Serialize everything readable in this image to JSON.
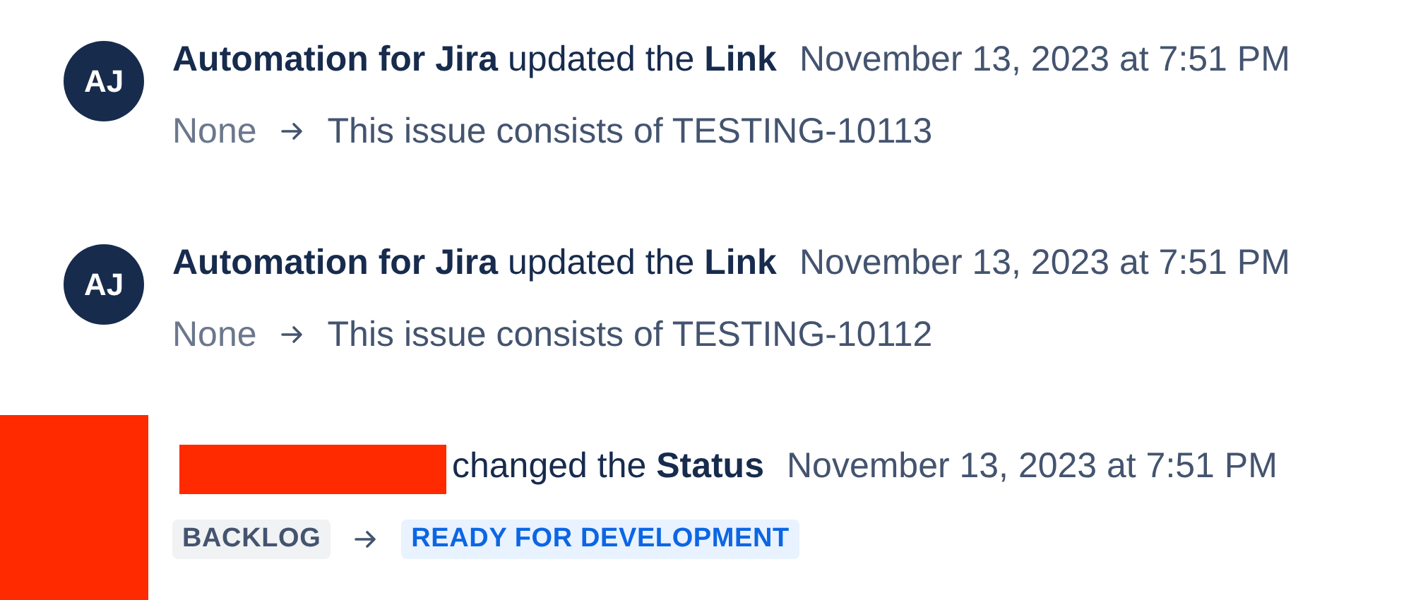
{
  "entries": [
    {
      "kind": "text",
      "redacted": false,
      "avatar": "AJ",
      "actor": "Automation for Jira",
      "action": "updated the",
      "field": "Link",
      "time": "November 13, 2023 at 7:51 PM",
      "from": "None",
      "to": "This issue consists of TESTING-10113"
    },
    {
      "kind": "text",
      "redacted": false,
      "avatar": "AJ",
      "actor": "Automation for Jira",
      "action": "updated the",
      "field": "Link",
      "time": "November 13, 2023 at 7:51 PM",
      "from": "None",
      "to": "This issue consists of TESTING-10112"
    },
    {
      "kind": "status",
      "redacted": true,
      "action": "changed the",
      "field": "Status",
      "time": "November 13, 2023 at 7:51 PM",
      "from": {
        "label": "BACKLOG",
        "color": "#f1f2f4"
      },
      "to": {
        "label": "READY FOR DEVELOPMENT",
        "color": "#e9f2ff"
      }
    }
  ]
}
